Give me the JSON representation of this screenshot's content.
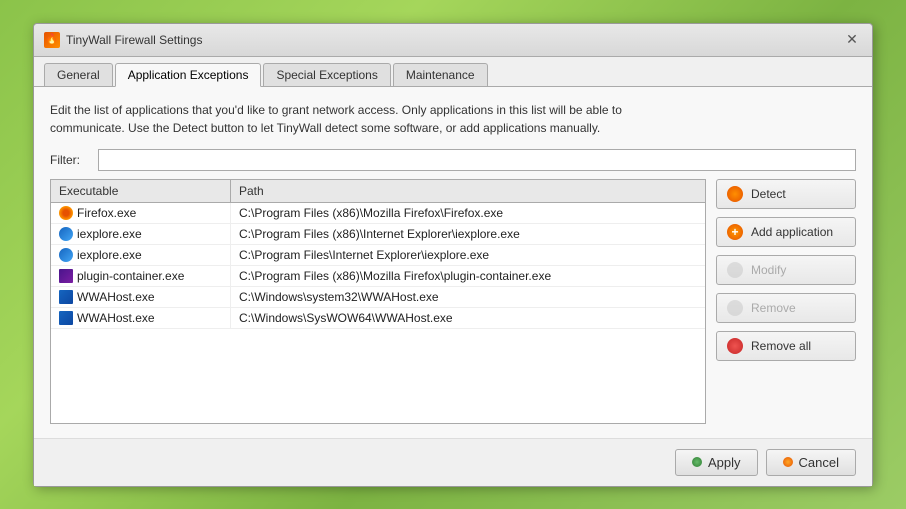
{
  "window": {
    "title": "TinyWall Firewall Settings",
    "icon": "firewall-icon"
  },
  "tabs": [
    {
      "label": "General",
      "active": false
    },
    {
      "label": "Application Exceptions",
      "active": true
    },
    {
      "label": "Special Exceptions",
      "active": false
    },
    {
      "label": "Maintenance",
      "active": false
    }
  ],
  "description": "Edit the list of applications that you'd like to grant network access. Only applications in this list will be able to\ncommunicate.  Use the Detect button to let TinyWall detect some software, or add applications manually.",
  "filter": {
    "label": "Filter:",
    "value": "",
    "placeholder": ""
  },
  "table": {
    "columns": [
      "Executable",
      "Path"
    ],
    "rows": [
      {
        "icon": "firefox",
        "executable": "Firefox.exe",
        "path": "C:\\Program Files (x86)\\Mozilla Firefox\\Firefox.exe"
      },
      {
        "icon": "ie",
        "executable": "iexplore.exe",
        "path": "C:\\Program Files (x86)\\Internet Explorer\\iexplore.exe"
      },
      {
        "icon": "ie",
        "executable": "iexplore.exe",
        "path": "C:\\Program Files\\Internet Explorer\\iexplore.exe"
      },
      {
        "icon": "plugin",
        "executable": "plugin-container.exe",
        "path": "C:\\Program Files (x86)\\Mozilla Firefox\\plugin-container.exe"
      },
      {
        "icon": "wwa",
        "executable": "WWAHost.exe",
        "path": "C:\\Windows\\system32\\WWAHost.exe"
      },
      {
        "icon": "wwa",
        "executable": "WWAHost.exe",
        "path": "C:\\Windows\\SysWOW64\\WWAHost.exe"
      }
    ]
  },
  "buttons": {
    "detect": "Detect",
    "add_application": "Add application",
    "modify": "Modify",
    "remove": "Remove",
    "remove_all": "Remove all",
    "apply": "Apply",
    "cancel": "Cancel"
  }
}
